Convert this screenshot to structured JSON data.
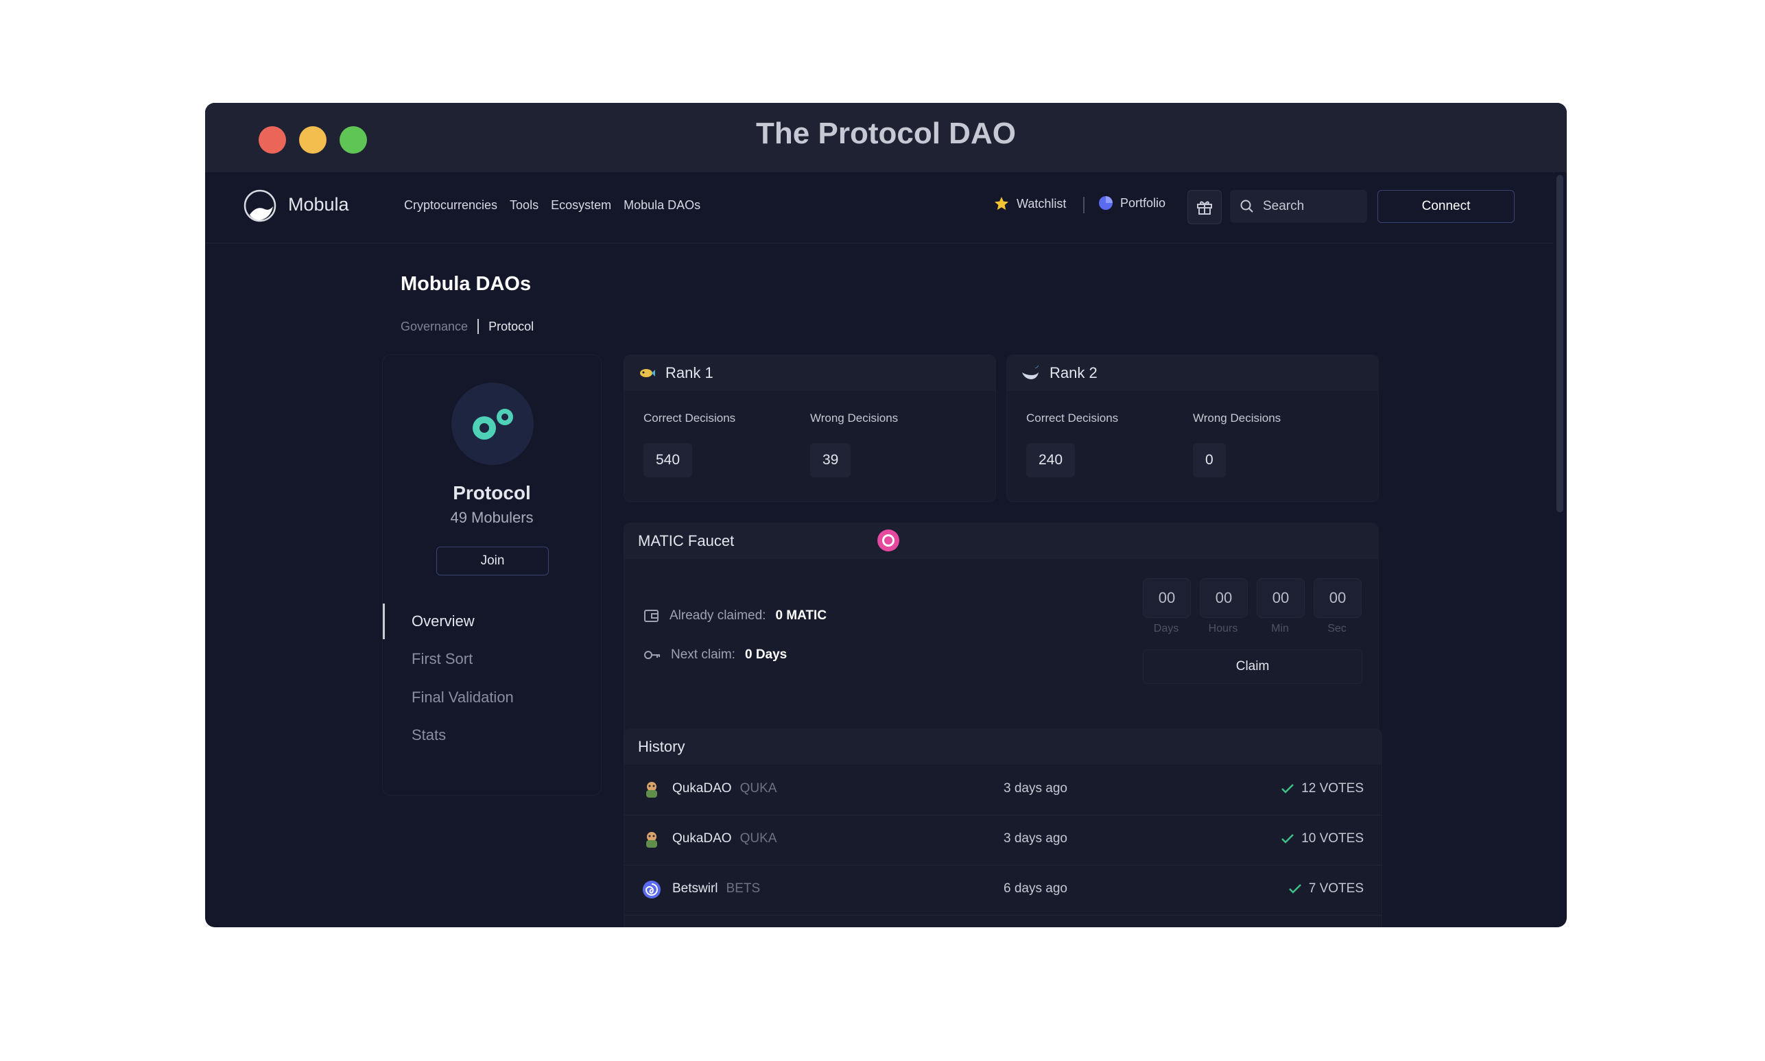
{
  "window": {
    "title": "The Protocol DAO"
  },
  "nav": {
    "brand": "Mobula",
    "links": [
      "Cryptocurrencies",
      "Tools",
      "Ecosystem",
      "Mobula DAOs"
    ],
    "watchlist": "Watchlist",
    "portfolio": "Portfolio",
    "search_label": "Search",
    "connect": "Connect"
  },
  "page": {
    "title": "Mobula DAOs",
    "breadcrumb": [
      "Governance",
      "Protocol"
    ]
  },
  "profile": {
    "name": "Protocol",
    "members": "49 Mobulers",
    "join": "Join",
    "menu": [
      "Overview",
      "First Sort",
      "Final Validation",
      "Stats"
    ],
    "active_menu": "Overview"
  },
  "ranks": [
    {
      "title": "Rank 1",
      "correct_label": "Correct Decisions",
      "wrong_label": "Wrong Decisions",
      "correct": "540",
      "wrong": "39"
    },
    {
      "title": "Rank 2",
      "correct_label": "Correct Decisions",
      "wrong_label": "Wrong Decisions",
      "correct": "240",
      "wrong": "0"
    }
  ],
  "faucet": {
    "title": "MATIC Faucet",
    "claimed_label": "Already claimed:",
    "claimed_value": "0 MATIC",
    "next_label": "Next claim:",
    "next_value": "0 Days",
    "countdown": [
      {
        "value": "00",
        "label": "Days"
      },
      {
        "value": "00",
        "label": "Hours"
      },
      {
        "value": "00",
        "label": "Min"
      },
      {
        "value": "00",
        "label": "Sec"
      }
    ],
    "claim": "Claim"
  },
  "history": {
    "title": "History",
    "rows": [
      {
        "name": "QukaDAO",
        "symbol": "QUKA",
        "time": "3 days ago",
        "votes": "12 VOTES"
      },
      {
        "name": "QukaDAO",
        "symbol": "QUKA",
        "time": "3 days ago",
        "votes": "10 VOTES"
      },
      {
        "name": "Betswirl",
        "symbol": "BETS",
        "time": "6 days ago",
        "votes": "7 VOTES"
      }
    ]
  },
  "colors": {
    "accent_border": "#3a4270",
    "check_green": "#3fc08a",
    "cursor_pink": "#e64aa0"
  },
  "icons": [
    "star-icon",
    "portfolio-pie-icon",
    "gift-icon",
    "search-icon",
    "wallet-icon",
    "key-icon",
    "check-icon",
    "gears-icon"
  ]
}
